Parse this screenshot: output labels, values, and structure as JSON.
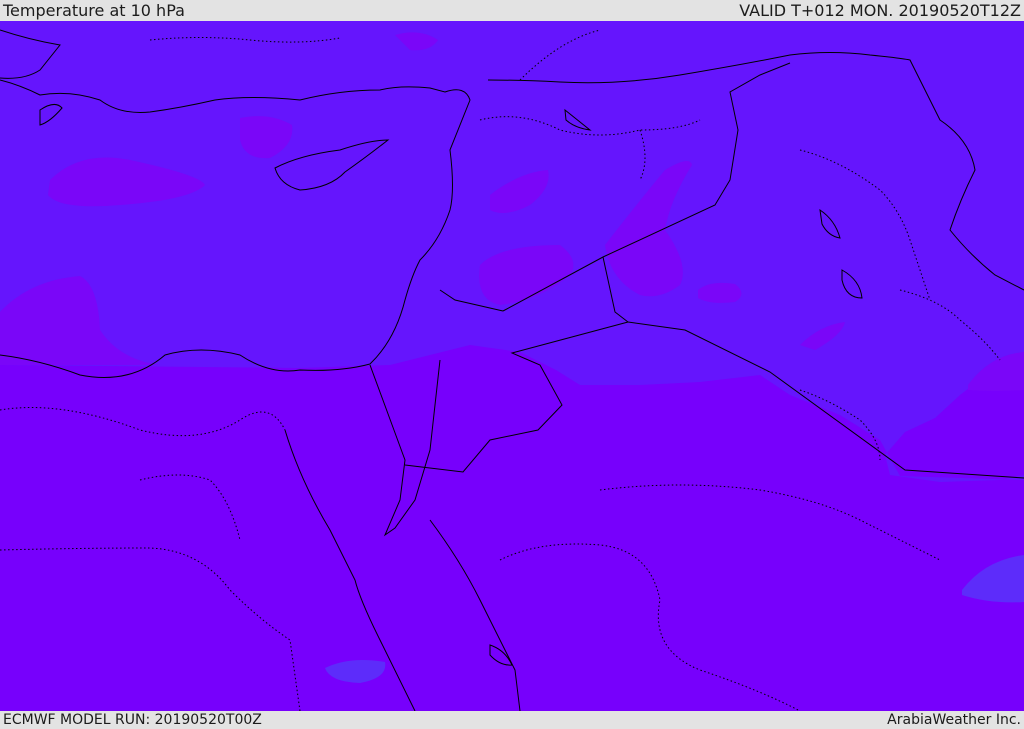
{
  "header": {
    "title": "Temperature at 10 hPa",
    "valid_time": "VALID T+012 MON. 20190520T12Z"
  },
  "footer": {
    "model_run": "ECMWF MODEL RUN: 20190520T00Z",
    "credit": "ArabiaWeather Inc."
  },
  "map": {
    "colors": {
      "field_cool": "#6515fd",
      "field_warm": "#7700fc",
      "blob": "#7a06f8",
      "cool_patch": "#5d2cfa",
      "coastline": "#000000"
    }
  }
}
